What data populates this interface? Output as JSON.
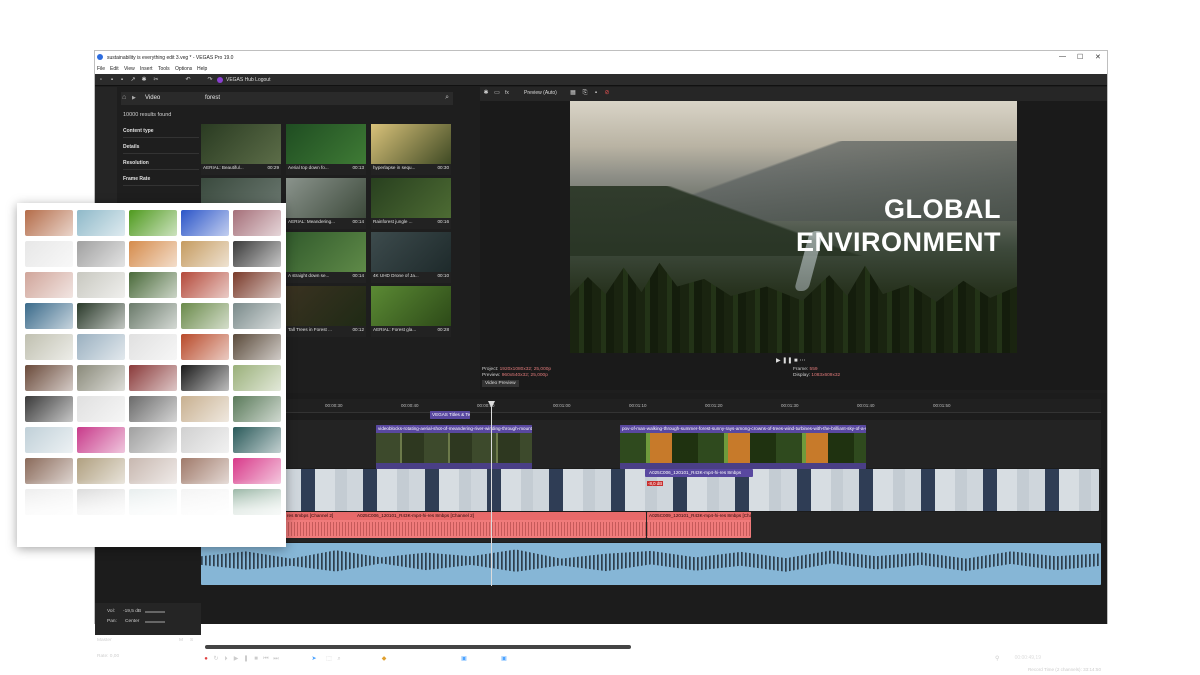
{
  "window": {
    "title": "sustainability is everything edit 3.veg * - VEGAS Pro 19.0",
    "min": "—",
    "max": "☐",
    "close": "✕"
  },
  "menu": [
    "File",
    "Edit",
    "View",
    "Insert",
    "Tools",
    "Options",
    "Help"
  ],
  "toolbar": {
    "hub_label": "VEGAS Hub Logout"
  },
  "media": {
    "tab_video": "Video",
    "search_query": "forest",
    "results": "10000 results found",
    "filters": [
      "Content type",
      "Details",
      "Resolution",
      "Frame Rate"
    ],
    "thumbs": [
      {
        "caption": "AERIAL: Beautiful...",
        "duration": "00:29",
        "colors": [
          "#2a3b22",
          "#5c6d48"
        ]
      },
      {
        "caption": "Aerial top down fo...",
        "duration": "00:13",
        "colors": [
          "#1f4d22",
          "#3f7b35"
        ]
      },
      {
        "caption": "hyperlapse in sequ...",
        "duration": "00:30",
        "colors": [
          "#d9c27a",
          "#3f4a24"
        ]
      },
      {
        "caption": "",
        "duration": "",
        "colors": [
          "#3a4a3e",
          "#6d7a72"
        ]
      },
      {
        "caption": "AERIAL: Meandering...",
        "duration": "00:14",
        "colors": [
          "#8a938c",
          "#3d4a3b"
        ]
      },
      {
        "caption": "Rainforest jungle ...",
        "duration": "00:16",
        "colors": [
          "#28401f",
          "#4d6b33"
        ]
      },
      {
        "caption": "",
        "duration": "",
        "colors": [
          "#3a3f3a",
          "#202520"
        ]
      },
      {
        "caption": "A straight down se...",
        "duration": "00:14",
        "colors": [
          "#315a2c",
          "#5f8a48"
        ]
      },
      {
        "caption": "4K UHD Drone of Ja...",
        "duration": "00:10",
        "colors": [
          "#3d4b4d",
          "#1e2a2b"
        ]
      },
      {
        "caption": "",
        "duration": "",
        "colors": [
          "#2d2d2d",
          "#1a1a1a"
        ]
      },
      {
        "caption": "Tall Trees in Forest ...",
        "duration": "00:12",
        "colors": [
          "#3a3221",
          "#1f2a15"
        ]
      },
      {
        "caption": "AERIAL: Forest gla...",
        "duration": "00:28",
        "colors": [
          "#5b8a34",
          "#2d4a18"
        ]
      }
    ]
  },
  "preview": {
    "mode": "Preview (Auto)",
    "title_line1": "GLOBAL",
    "title_line2": "ENVIRONMENT",
    "project_label": "Project:",
    "project_value": "1920x1080x32; 25,000p",
    "preview_label": "Preview:",
    "preview_value": "960x540x32; 25,000p",
    "frame_label": "Frame:",
    "frame_value": "559",
    "display_label": "Display:",
    "display_value": "1083x609x32",
    "tab": "Video Preview"
  },
  "timeline": {
    "ticks": [
      "00:00:10",
      "00:00:20",
      "00:00:30",
      "00:00:40",
      "00:00:50",
      "00:01:00",
      "00:01:10",
      "00:01:20",
      "00:01:30",
      "00:01:40",
      "00:01:50"
    ],
    "title_clip": "VEGAS Titles & Text",
    "clip1": "videoblocks-rotating-aerial-shot-of-meandering-river-winding-through-mounta...",
    "clip2": "pov-of-man-walking-through-summer-forest-sunny-rays-among-crowns-of-trees-wind-turbines-with-the-brilliant-sky-of-a-se",
    "speaker_clip": "A025C006_120101_R43K-mp4-hi-res 8mbps",
    "audio_clip1": "res 8mbps [Channel 2]",
    "audio_clip2": "A025C006_120101_R43K-mp4-hi-res 8mbps [Channel 2]",
    "audio_clip3": "A025C009_120101_R43K-mp4-hi-res 8mbps [Channel 2]",
    "level_marker": "-8,0 dB",
    "vol_label": "Vol:",
    "vol_value": "-19,5 dB",
    "pan_label": "Pan:",
    "pan_value": "Center",
    "master": "Master",
    "rate": "Rate: 0,00",
    "time": "00:00:49,19",
    "record_time": "Record Time (2 channels): 33:14:50"
  },
  "photo_panel": {
    "colors": [
      [
        "#b46c49",
        "#8fb9c9",
        "#4f9a1e",
        "#2b55c8",
        "#a56f79"
      ],
      [
        "#e7e7e7",
        "#a0a0a0",
        "#d58b4b",
        "#c59b60",
        "#3a3a3a"
      ],
      [
        "#d0a59a",
        "#c8c8c0",
        "#4a6a3a",
        "#b44a3a",
        "#7a3a2a"
      ],
      [
        "#3a6a8a",
        "#2a3a2a",
        "#6a7a6a",
        "#6a8a4a",
        "#7a8a8a"
      ],
      [
        "#c0c0b0",
        "#9ab0c0",
        "#e0e0e0",
        "#b84a2a",
        "#5a4a3a"
      ],
      [
        "#6a4a3a",
        "#8a8a7a",
        "#8a3a3a",
        "#1a1a1a",
        "#9ab07a"
      ],
      [
        "#3a3a3a",
        "#e0e0e0",
        "#6a6a6a",
        "#c8b090",
        "#5a7a5a"
      ],
      [
        "#c0d0d8",
        "#c83a8a",
        "#a0a0a0",
        "#d0d0d0",
        "#2a5a5a"
      ],
      [
        "#8a6a5a",
        "#b0a080",
        "#c8b8b0",
        "#a07a6a",
        "#d83a8a"
      ],
      [
        "#e8e8e8",
        "#d0d0d0",
        "#e0e8e8",
        "#f0f0f0",
        "#7aa08a"
      ]
    ]
  }
}
